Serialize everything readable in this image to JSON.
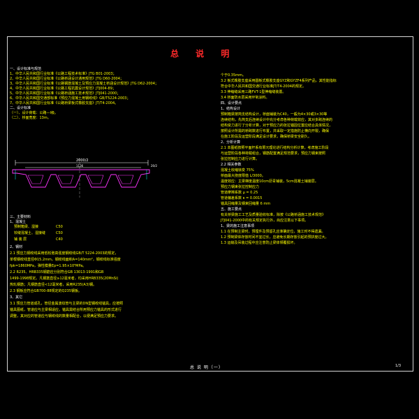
{
  "title": "总 说 明",
  "left": {
    "sec1_head": "一、设计标准与规范",
    "refs": [
      "1、中华人民共和国行业标准《公路工程技术标准》JTG B01-2003；",
      "2、中华人民共和国行业标准《公路桥涵设计通用规范》JTG D60-2004；",
      "3、中华人民共和国行业标准《公路钢筋混凝土及预应力混凝土桥涵设计规范》JTG D62-2004；",
      "4、中华人民共和国行业标准《公路工程抗震设计规范》JTJ004-89；",
      "5、中华人民共和国行业标准《公路桥涵施工技术规范》JTJ041-2000；",
      "6、中华人民共和国交通部标准《预应力混凝土用钢绞线》GB/T5224-2003；",
      "7、中华人民共和国行业标准《公路桥梁板式橡胶支座》JT/T4-2004。"
    ],
    "sec2_head": "二、设计标准",
    "std_items": [
      "（一）、设计荷载：公路—I级。",
      "（二）、桥面宽度：13m。"
    ],
    "section_dims": {
      "top": "2000/2",
      "mid": "1136",
      "right": "20/2"
    },
    "sec3_head": "三、主要材料",
    "concrete_head": "1、混凝土",
    "concrete": [
      {
        "name": "预制箱梁、湿接",
        "grade": "C50"
      },
      {
        "name": "铰缝混凝土、湿接缝",
        "grade": "C50"
      },
      {
        "name": "铺 装 层",
        "grade": "C40"
      }
    ],
    "steel_head": "2、钢材",
    "steel_lines": [
      "2.1 预应力钢绞线采用低松弛高强度钢绞线GB/T 5224-2003的规定，",
      "单根钢绞线直径Φ15.2mm，钢绞线面积A=140mm²，钢绞线标准强度",
      "fpk=1860MPa，弹性模量Ep=1.95×10⁵MPa。",
      "2.2 R235、HRB335钢筋应分别符合GB 13013-1991和GB",
      "1499-1998规定。凡钢筋直径≥12毫米者，均采用HRB335(20MnSi)",
      "热轧钢筋；凡钢筋直径<12毫米者，采用R235(A3)钢。",
      "2.3 钢板应符合GB700-88规定的Q235钢板。"
    ],
    "other_head": "3、其它",
    "other_lines": [
      "3.1 预应力管道成孔，管径金属波纹管与主梁的DN型钢绞线锚具，应按照",
      "锚具图纸，管道应与主梁相适应，锚具需结合所用预应力锚具的形式进行",
      "调整，其对应的管道应与钢绞线的数量相配合，以便满足预应力要求。"
    ]
  },
  "right": {
    "top_lines": [
      "个于0.35mm。",
      "3.2 板式橡胶支座采用圆板式橡胶支座GYZ和GYZF4系列产品，其性能指标",
      "符合中华人民共和国交通行业标准JT/T4-2004的规定。",
      "3.3 伸缩缝采用三路FVT-1型伸缩缝装置。",
      "3.4 桥面防水层采用环氧涂料。"
    ],
    "sec4_head": "四、设计要点",
    "p1_head": "1、结构设计",
    "p1_lines": [
      "预制箱梁按简支结构设计，桥面铺装为C40，一般为4×30或3×30等",
      "连续结构，先简支后连续设计中充分考虑各种荷载效应，其对多跨连续的",
      "结构受力进行了分析计算，对于预应力的张拉锚固位置应结合具体情况，",
      "按照设计所需的桥跨数进行布置，并采取一定措施防止横向开裂，确保",
      "在施工阶段及运营阶段满足设计要求，确保桥梁安全耐久。"
    ],
    "p2_head": "2、分析计算",
    "p2_lines": [
      "2.1 本图纸按照平面杆系有限元理论进行结构分析计算，考虑施工阶段",
      "与运营阶段各种荷载组合，钢筋配置满足规范要求，预应力钢束按照",
      "张拉控制应力进行计算。"
    ],
    "p22_head": "2.2 相关参数",
    "params": [
      "混凝土收缩徐变  75%",
      "桥面最大挠度限值 L/3000。",
      "温度效应：主梁梯度温度10cm沥青铺装，5cm混凝土铺装层。",
      "预应力钢束张拉控制应力",
      "管道摩擦系数  μ = 0.25",
      "管道偏差系数  κ = 0.0015",
      "锚具回缩量及钢束回缩量  6 mm"
    ],
    "sec5_head": "五、施工要点",
    "sec5_lines": [
      "有关桥梁施工工艺及质量验收标准，除按《公路桥涵施工技术规范》",
      "JTJ041-2000中的有关规定执行外，尚应注意以下事项。"
    ],
    "p51_head": "1、梁的施工注意事项",
    "p51_lines": [
      "1.1 在预制主梁时，预埋件及预留孔应准确定位，施工时不得遗漏。",
      "1.2 预制梁体存放时间不宜过长，应避免长期存放引起的预拱度过大。",
      "1.3 运输及吊装过程中应注意防止梁体倾覆损坏。"
    ]
  },
  "footer": {
    "title": "总 说 明（一）",
    "page": "1/3"
  }
}
